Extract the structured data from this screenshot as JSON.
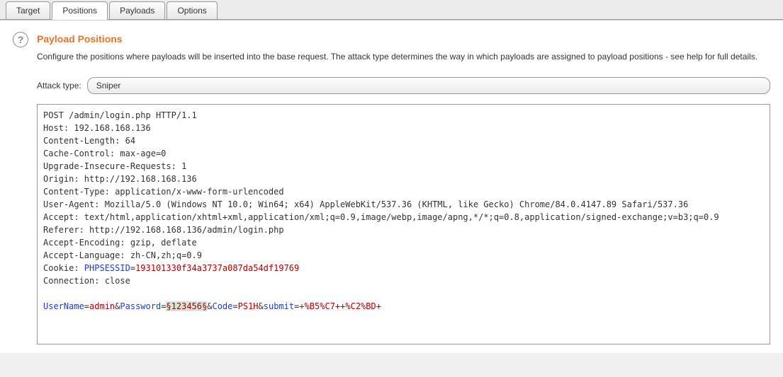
{
  "tabs": {
    "target": "Target",
    "positions": "Positions",
    "payloads": "Payloads",
    "options": "Options"
  },
  "page": {
    "title": "Payload Positions",
    "description": "Configure the positions where payloads will be inserted into the base request. The attack type determines the way in which payloads are assigned to payload positions - see help for full details."
  },
  "attack": {
    "label": "Attack type:",
    "value": "Sniper"
  },
  "request": {
    "line1": "POST /admin/login.php HTTP/1.1",
    "line2": "Host: 192.168.168.136",
    "line3": "Content-Length: 64",
    "line4": "Cache-Control: max-age=0",
    "line5": "Upgrade-Insecure-Requests: 1",
    "line6": "Origin: http://192.168.168.136",
    "line7": "Content-Type: application/x-www-form-urlencoded",
    "line8": "User-Agent: Mozilla/5.0 (Windows NT 10.0; Win64; x64) AppleWebKit/537.36 (KHTML, like Gecko) Chrome/84.0.4147.89 Safari/537.36",
    "line9": "Accept: text/html,application/xhtml+xml,application/xml;q=0.9,image/webp,image/apng,*/*;q=0.8,application/signed-exchange;v=b3;q=0.9",
    "line10": "Referer: http://192.168.168.136/admin/login.php",
    "line11": "Accept-Encoding: gzip, deflate",
    "line12": "Accept-Language: zh-CN,zh;q=0.9",
    "cookie_label": "Cookie: ",
    "cookie_key": "PHPSESSID",
    "cookie_eq": "=",
    "cookie_val": "193101330f34a3737a087da54df19769",
    "line14": "Connection: close",
    "body_k1": "UserName",
    "body_eq": "=",
    "body_v1": "admin",
    "body_amp": "&",
    "body_k2": "Password",
    "body_marker_open": "§",
    "body_v2": "123456",
    "body_marker_close": "§",
    "body_k3": "Code",
    "body_v3": "PS1H",
    "body_k4": "submit",
    "body_v4": "+%B5%C7++%C2%BD+"
  }
}
